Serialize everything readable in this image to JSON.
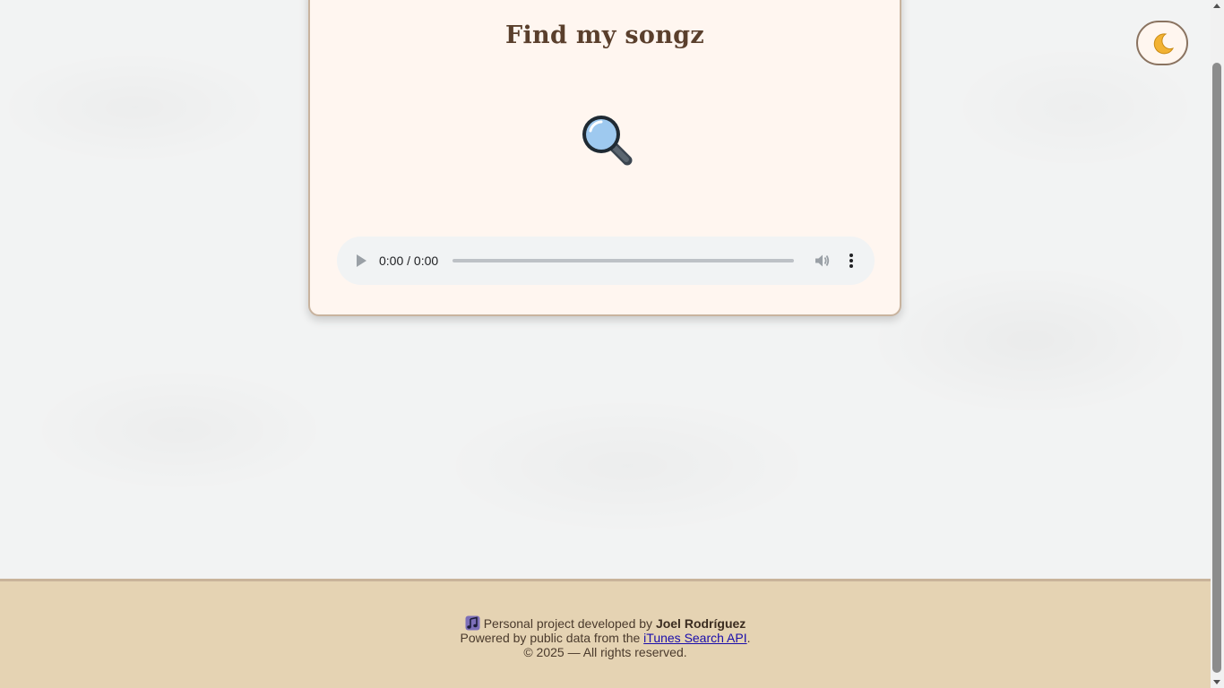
{
  "app": {
    "title": "Find my songz"
  },
  "search": {
    "icon": "magnifier-icon"
  },
  "audio_player": {
    "time": "0:00 / 0:00",
    "progress_fraction": 0
  },
  "theme_toggle": {
    "icon": "crescent-moon-icon"
  },
  "footer": {
    "line1_prefix": "Personal project developed by",
    "author": "Joel Rodríguez",
    "line2_prefix": "Powered by public data from the",
    "link_text": "iTunes Search API",
    "line2_suffix": ".",
    "copyright": "© 2025 — All rights reserved."
  },
  "colors": {
    "card_bg": "#fff6f0",
    "title": "#5a3f2c",
    "footer_bg": "#e5d3b3",
    "link": "#1a0dab"
  }
}
